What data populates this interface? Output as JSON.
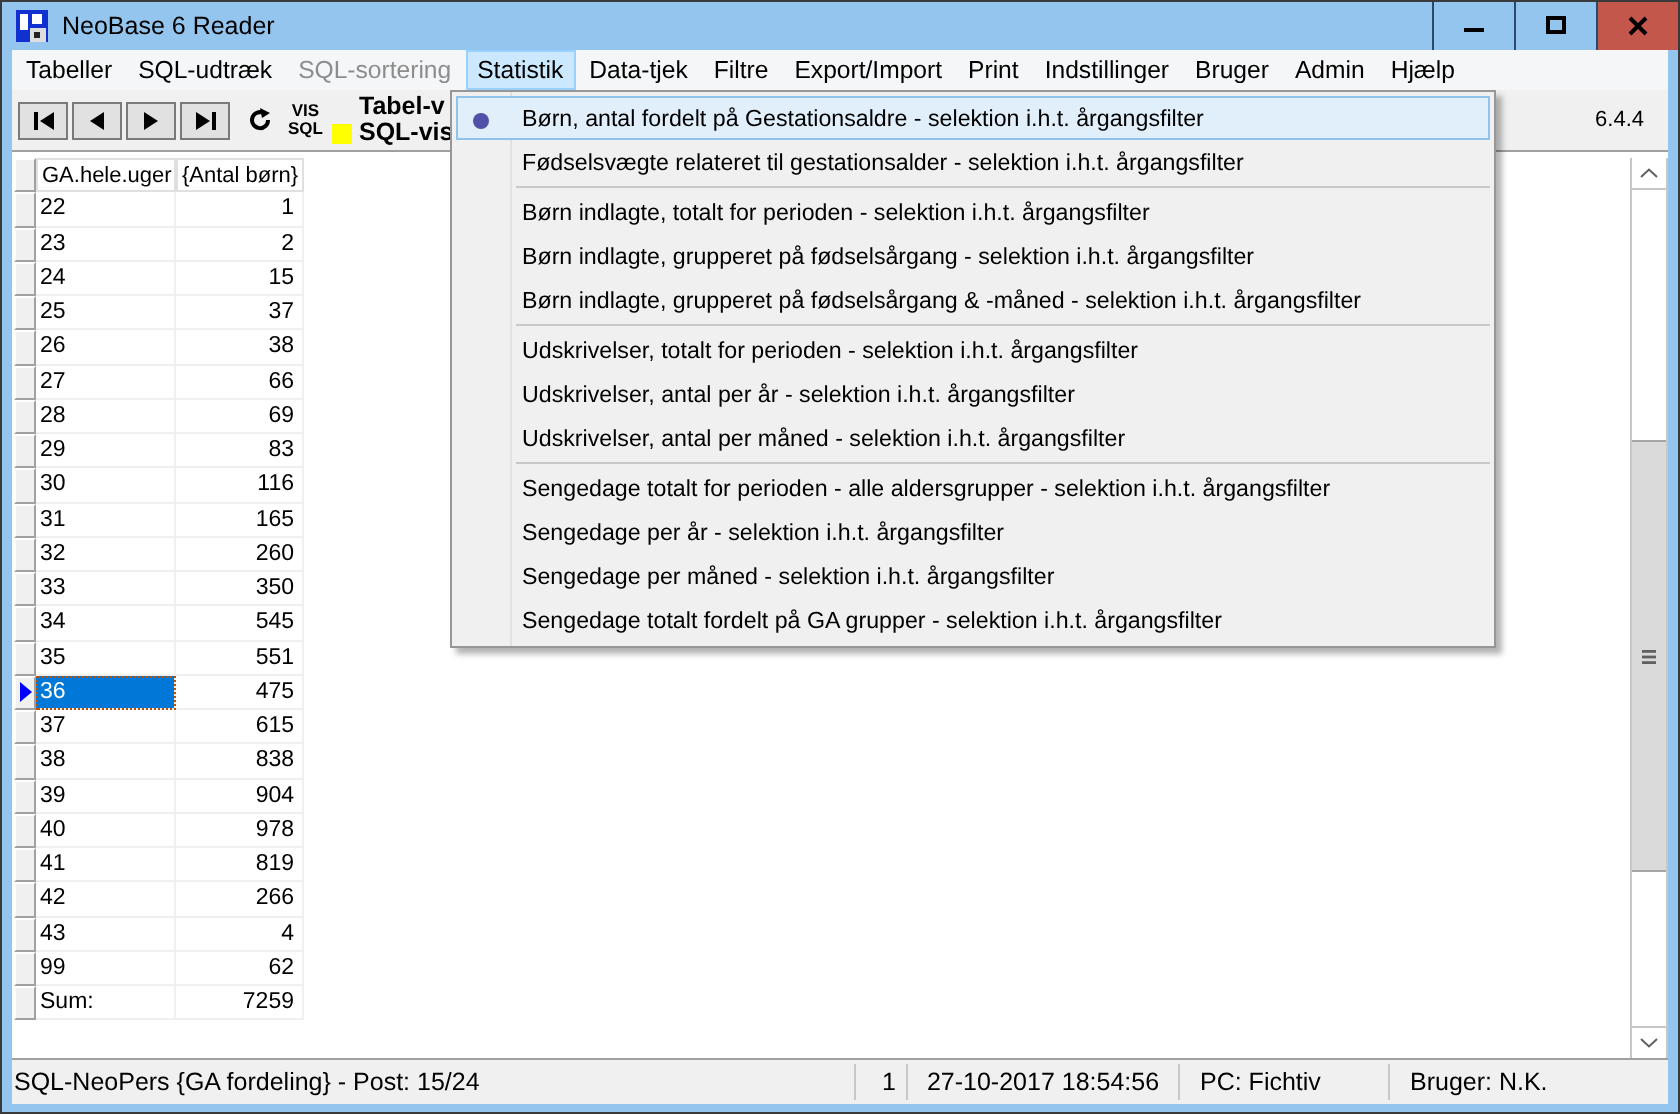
{
  "window": {
    "title": "NeoBase 6 Reader"
  },
  "menu_bar": [
    {
      "label": "Tabeller",
      "selected": false,
      "disabled": false
    },
    {
      "label": "SQL-udtræk",
      "selected": false,
      "disabled": false
    },
    {
      "label": "SQL-sortering",
      "selected": false,
      "disabled": true
    },
    {
      "label": "Statistik",
      "selected": true,
      "disabled": false
    },
    {
      "label": "Data-tjek",
      "selected": false,
      "disabled": false
    },
    {
      "label": "Filtre",
      "selected": false,
      "disabled": false
    },
    {
      "label": "Export/Import",
      "selected": false,
      "disabled": false
    },
    {
      "label": "Print",
      "selected": false,
      "disabled": false
    },
    {
      "label": "Indstillinger",
      "selected": false,
      "disabled": false
    },
    {
      "label": "Bruger",
      "selected": false,
      "disabled": false
    },
    {
      "label": "Admin",
      "selected": false,
      "disabled": false
    },
    {
      "label": "Hjælp",
      "selected": false,
      "disabled": false
    }
  ],
  "toolbar": {
    "vis_sql": [
      "VIS",
      "SQL"
    ],
    "labels": [
      "Tabel-v",
      "SQL-vis"
    ],
    "version": "6.4.4"
  },
  "statistik_menu": {
    "groups": [
      [
        {
          "label": "Børn, antal fordelt på Gestationsaldre - selektion i.h.t. årgangsfilter",
          "selected": true
        },
        {
          "label": "Fødselsvægte relateret til gestationsalder - selektion i.h.t. årgangsfilter",
          "selected": false
        }
      ],
      [
        {
          "label": "Børn indlagte, totalt for perioden - selektion i.h.t. årgangsfilter",
          "selected": false
        },
        {
          "label": "Børn indlagte, grupperet på fødselsårgang - selektion i.h.t. årgangsfilter",
          "selected": false
        },
        {
          "label": "Børn indlagte, grupperet på fødselsårgang & -måned - selektion i.h.t. årgangsfilter",
          "selected": false
        }
      ],
      [
        {
          "label": "Udskrivelser, totalt for perioden - selektion i.h.t. årgangsfilter",
          "selected": false
        },
        {
          "label": "Udskrivelser, antal per år - selektion i.h.t. årgangsfilter",
          "selected": false
        },
        {
          "label": "Udskrivelser, antal per måned - selektion i.h.t. årgangsfilter",
          "selected": false
        }
      ],
      [
        {
          "label": "Sengedage totalt for perioden - alle aldersgrupper - selektion i.h.t. årgangsfilter",
          "selected": false
        },
        {
          "label": "Sengedage per år - selektion i.h.t. årgangsfilter",
          "selected": false
        },
        {
          "label": "Sengedage per måned - selektion i.h.t. årgangsfilter",
          "selected": false
        },
        {
          "label": "Sengedage totalt fordelt på GA grupper - selektion i.h.t. årgangsfilter",
          "selected": false
        }
      ]
    ]
  },
  "table": {
    "columns": [
      "GA.hele.uger",
      "{Antal børn}"
    ],
    "rows": [
      {
        "cells": [
          "22",
          "1"
        ],
        "selected": false
      },
      {
        "cells": [
          "23",
          "2"
        ],
        "selected": false
      },
      {
        "cells": [
          "24",
          "15"
        ],
        "selected": false
      },
      {
        "cells": [
          "25",
          "37"
        ],
        "selected": false
      },
      {
        "cells": [
          "26",
          "38"
        ],
        "selected": false
      },
      {
        "cells": [
          "27",
          "66"
        ],
        "selected": false
      },
      {
        "cells": [
          "28",
          "69"
        ],
        "selected": false
      },
      {
        "cells": [
          "29",
          "83"
        ],
        "selected": false
      },
      {
        "cells": [
          "30",
          "116"
        ],
        "selected": false
      },
      {
        "cells": [
          "31",
          "165"
        ],
        "selected": false
      },
      {
        "cells": [
          "32",
          "260"
        ],
        "selected": false
      },
      {
        "cells": [
          "33",
          "350"
        ],
        "selected": false
      },
      {
        "cells": [
          "34",
          "545"
        ],
        "selected": false
      },
      {
        "cells": [
          "35",
          "551"
        ],
        "selected": false
      },
      {
        "cells": [
          "36",
          "475"
        ],
        "selected": true
      },
      {
        "cells": [
          "37",
          "615"
        ],
        "selected": false
      },
      {
        "cells": [
          "38",
          "838"
        ],
        "selected": false
      },
      {
        "cells": [
          "39",
          "904"
        ],
        "selected": false
      },
      {
        "cells": [
          "40",
          "978"
        ],
        "selected": false
      },
      {
        "cells": [
          "41",
          "819"
        ],
        "selected": false
      },
      {
        "cells": [
          "42",
          "266"
        ],
        "selected": false
      },
      {
        "cells": [
          "43",
          "4"
        ],
        "selected": false
      },
      {
        "cells": [
          "99",
          "62"
        ],
        "selected": false
      },
      {
        "cells": [
          "Sum:",
          "7259"
        ],
        "selected": false
      }
    ]
  },
  "status_bar": [
    "SQL-NeoPers {GA fordeling} -  Post: 15/24",
    "1",
    "27-10-2017 18:54:56",
    "PC:  Fichtiv",
    "Bruger:  N.K."
  ]
}
